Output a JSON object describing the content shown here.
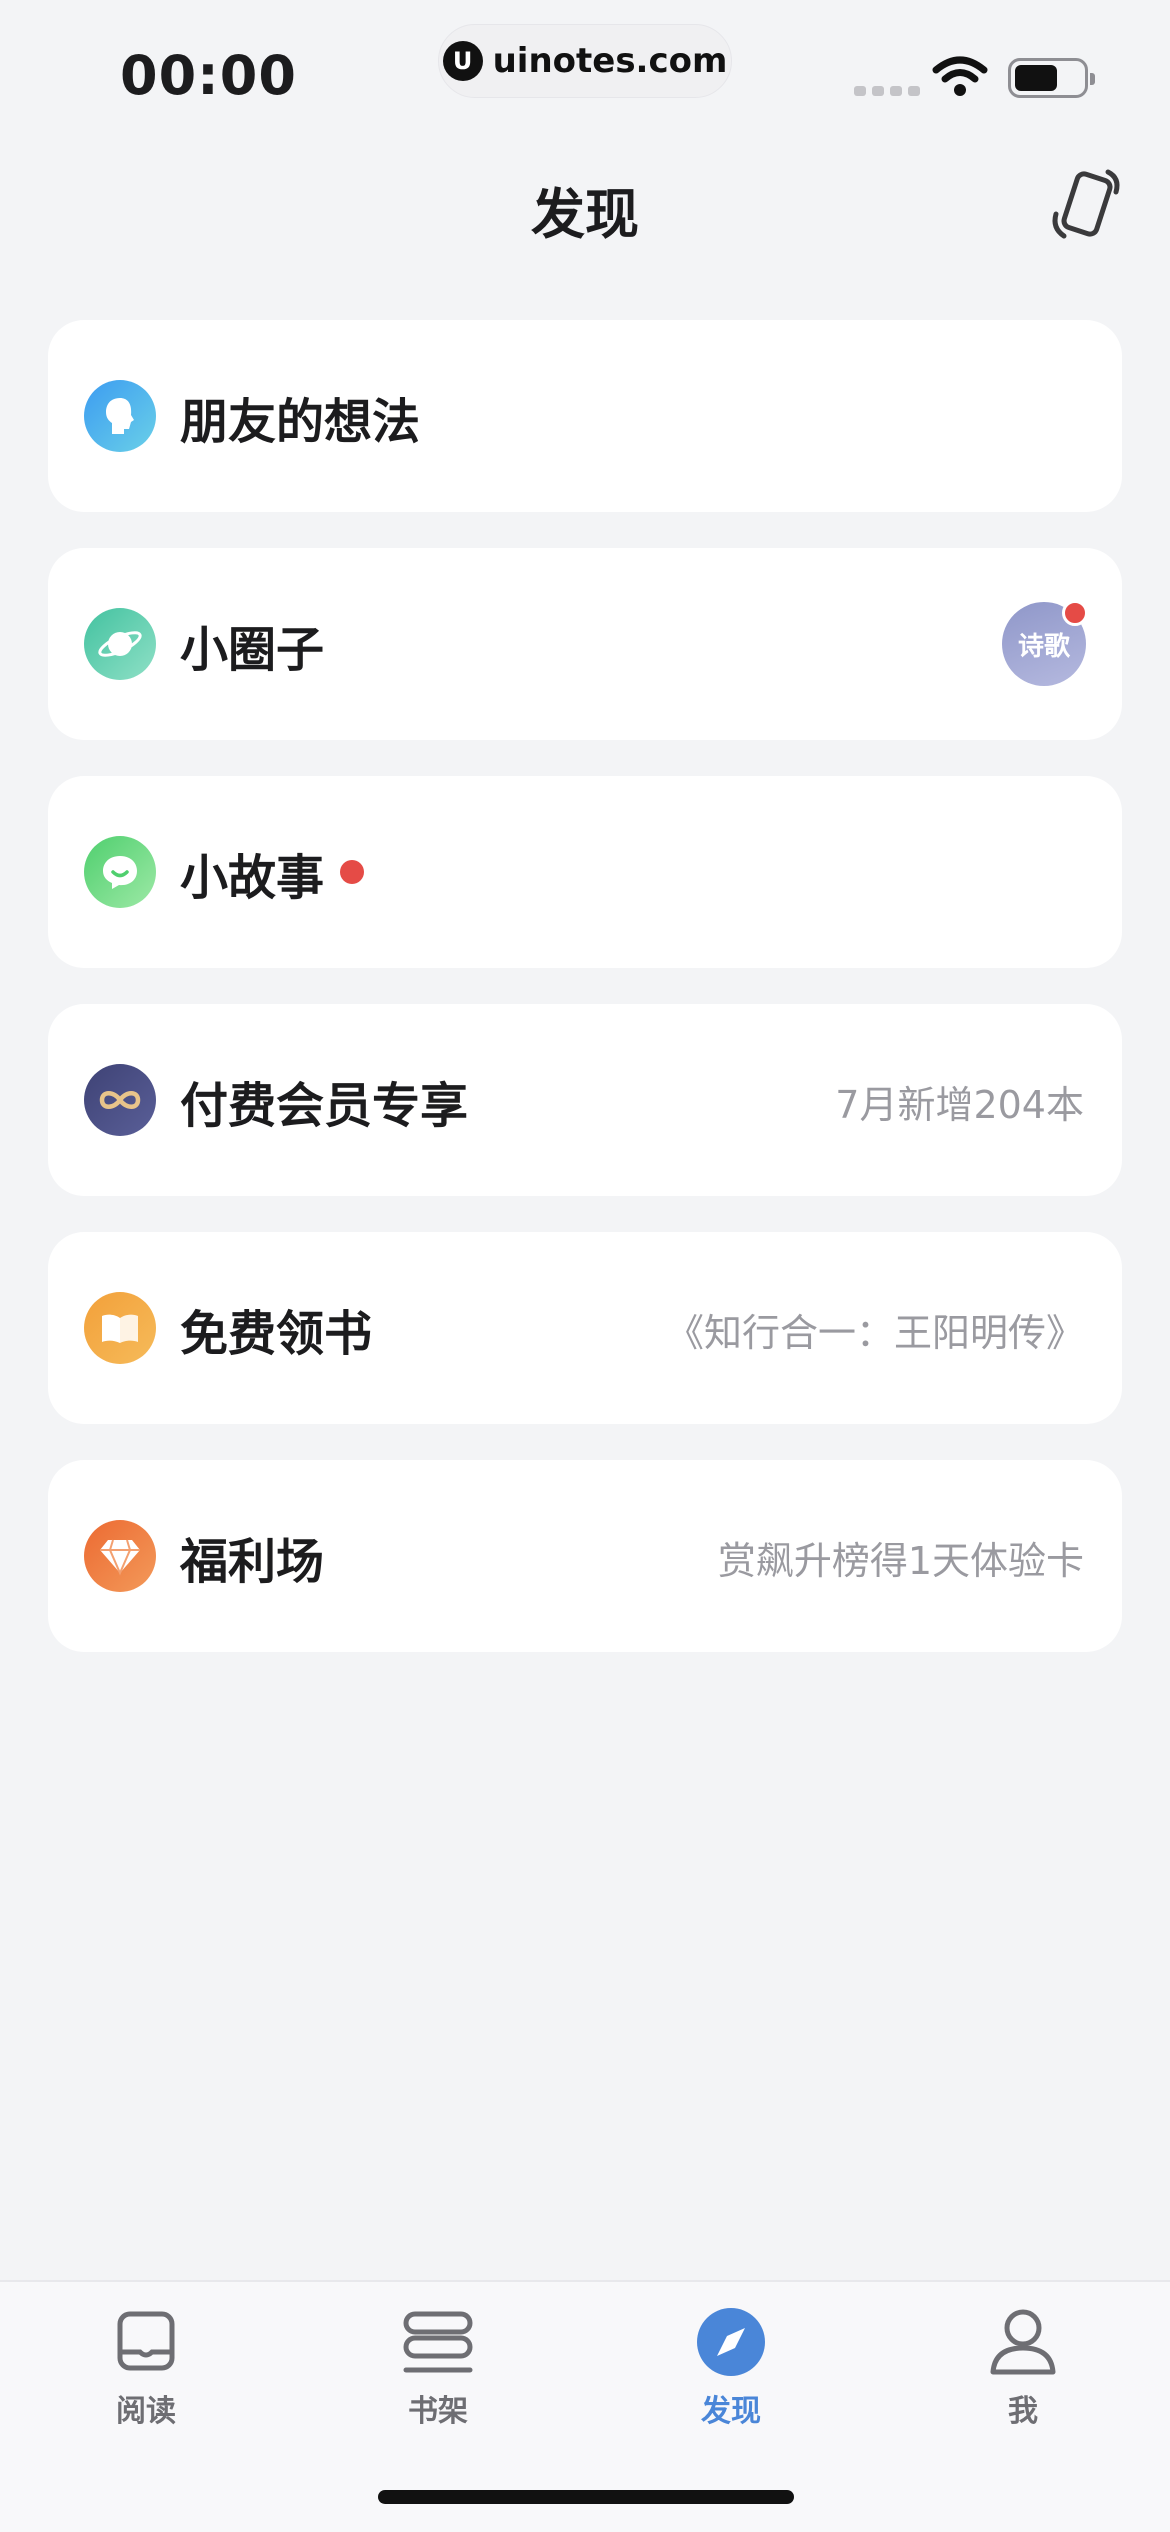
{
  "status_bar": {
    "time": "00:00",
    "url": "uinotes.com",
    "url_logo_letter": "U"
  },
  "header": {
    "title": "发现",
    "rotate_icon": "phone-rotate-icon"
  },
  "items": [
    {
      "label": "朋友的想法",
      "icon": "head-icon",
      "colors": [
        "#3c9cf1",
        "#6ad0e8"
      ],
      "detail": ""
    },
    {
      "label": "小圈子",
      "icon": "planet-icon",
      "colors": [
        "#43c2a0",
        "#8fe0c6"
      ],
      "detail": "",
      "avatar_text": "诗歌"
    },
    {
      "label": "小故事",
      "icon": "chat-bubble-icon",
      "colors": [
        "#4fcf6e",
        "#9de9a6"
      ],
      "detail": ""
    },
    {
      "label": "付费会员专享",
      "icon": "infinity-icon",
      "colors": [
        "#3e4275",
        "#5a5f98"
      ],
      "detail": "7月新增204本"
    },
    {
      "label": "免费领书",
      "icon": "open-book-icon",
      "colors": [
        "#f2a03a",
        "#f6bb5a"
      ],
      "detail": "《知行合一：王阳明传》"
    },
    {
      "label": "福利场",
      "icon": "diamond-icon",
      "colors": [
        "#ec6a32",
        "#f39a5a"
      ],
      "detail": "赏飙升榜得1天体验卡"
    }
  ],
  "tabs": [
    {
      "label": "阅读",
      "icon": "book-icon",
      "active": false
    },
    {
      "label": "书架",
      "icon": "bookshelf-icon",
      "active": false
    },
    {
      "label": "发现",
      "icon": "compass-icon",
      "active": true
    },
    {
      "label": "我",
      "icon": "person-icon",
      "active": false
    }
  ],
  "colors": {
    "accent": "#4a86d8",
    "badge_red": "#e54b46",
    "background": "#f3f4f6"
  }
}
